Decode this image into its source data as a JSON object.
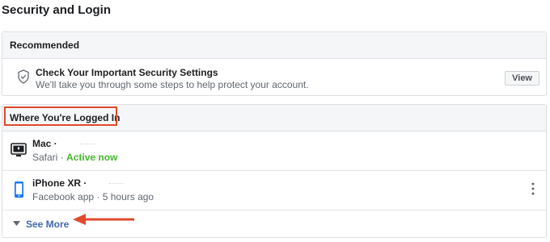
{
  "page": {
    "title": "Security and Login"
  },
  "recommended": {
    "header": "Recommended",
    "item": {
      "icon": "shield-icon",
      "title": "Check Your Important Security Settings",
      "description": "We'll take you through some steps to help protect your account.",
      "button_label": "View"
    }
  },
  "logged_in": {
    "header": "Where You're Logged In",
    "sessions": [
      {
        "icon": "desktop-icon",
        "device": "Mac ·",
        "app": "Safari ·",
        "status": "Active now"
      },
      {
        "icon": "phone-icon",
        "device": "iPhone XR ·",
        "app": "Facebook app · 5 hours ago",
        "status": ""
      }
    ],
    "see_more_label": "See More"
  },
  "colors": {
    "accent": "#4267b2",
    "active": "#42b72a",
    "annotation": "#e04a2e"
  }
}
